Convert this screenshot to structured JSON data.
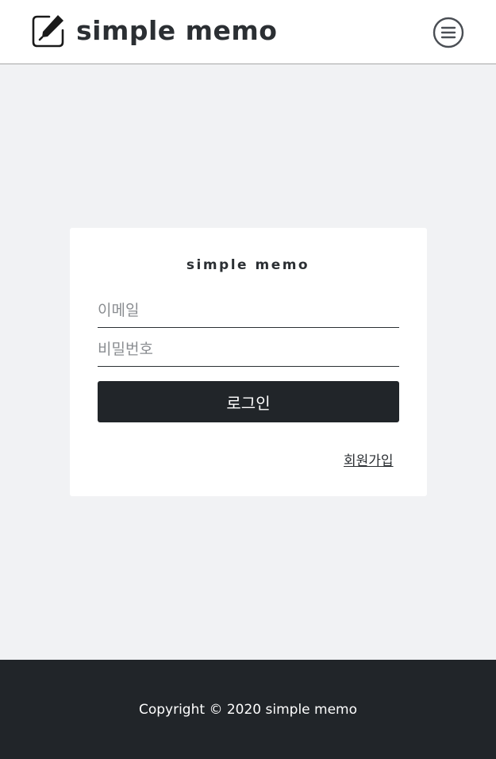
{
  "header": {
    "brand_text": "simple memo",
    "brand_icon": "edit-note-icon",
    "menu_icon": "hamburger-menu-icon"
  },
  "login": {
    "title": "simple memo",
    "email_placeholder": "이메일",
    "password_placeholder": "비밀번호",
    "login_label": "로그인",
    "signup_label": "회원가입"
  },
  "footer": {
    "copyright": "Copyright © 2020 simple memo"
  },
  "colors": {
    "background": "#f1f2f4",
    "dark": "#212529",
    "text": "#2b2f33",
    "card": "#ffffff"
  }
}
